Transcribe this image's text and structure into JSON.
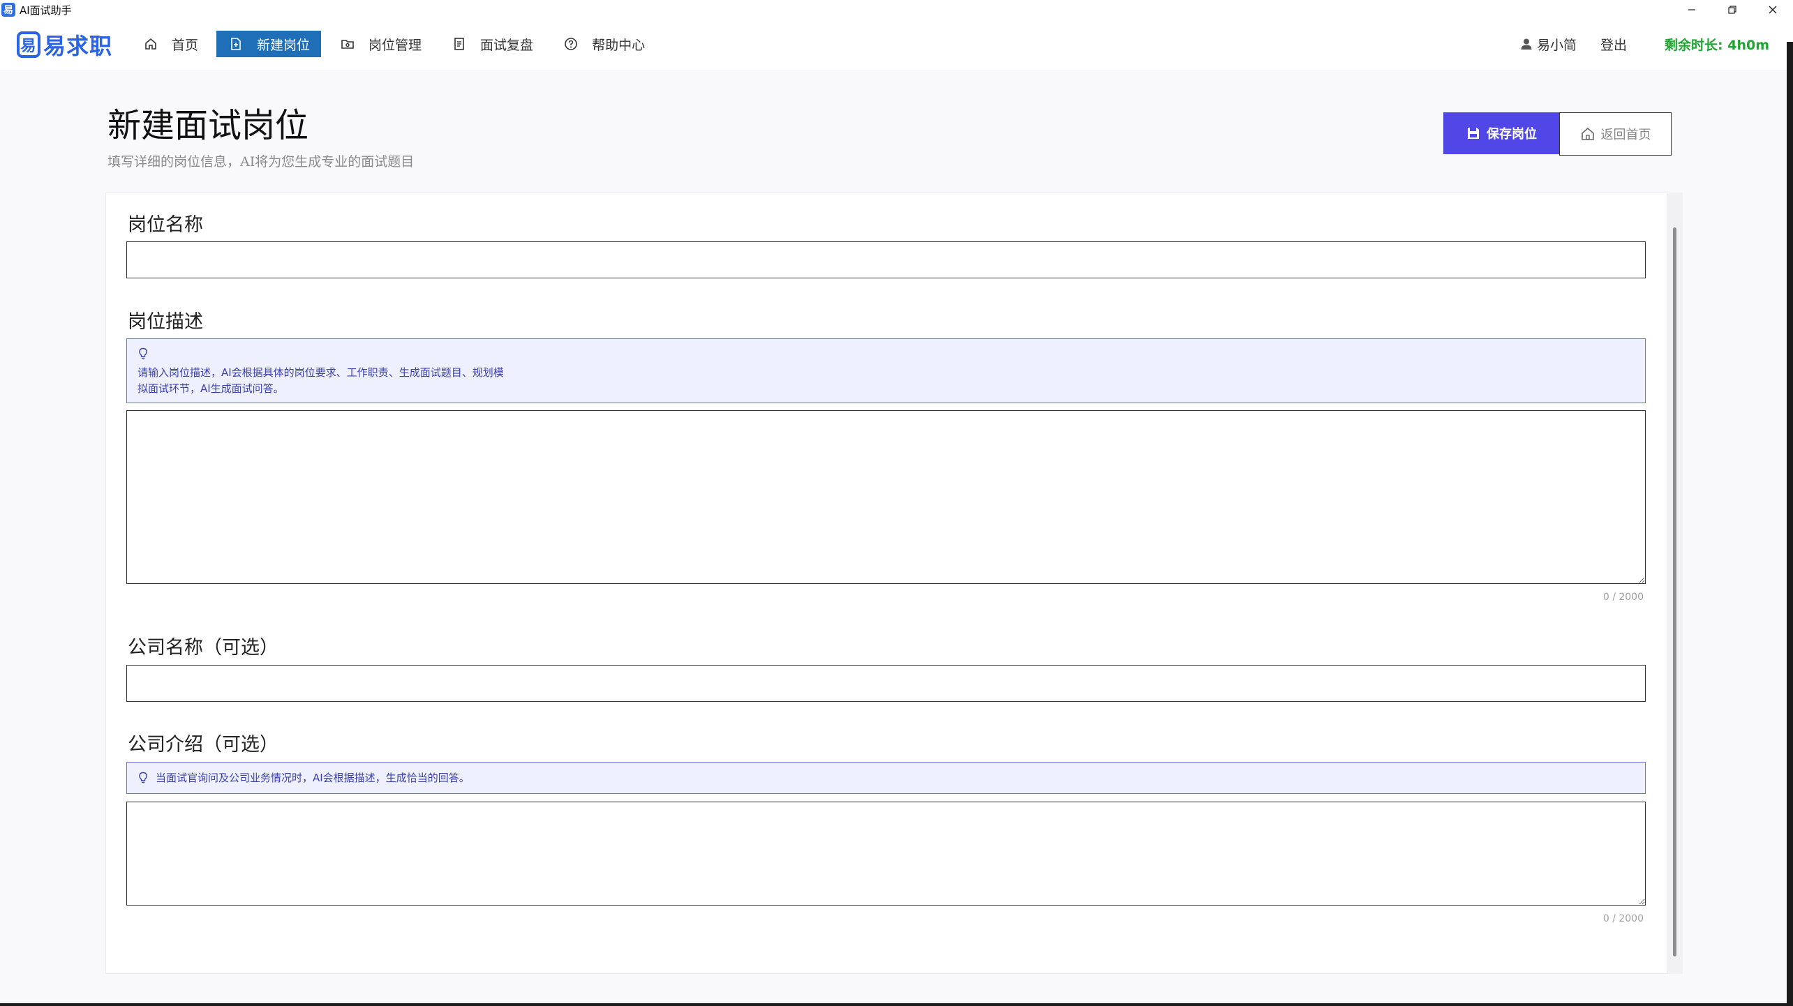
{
  "window": {
    "title": "AI面试助手",
    "app_icon": "易",
    "controls": [
      "minimize",
      "restore",
      "close"
    ]
  },
  "nav": {
    "logo_text": "易求职",
    "logo_mark": "易",
    "items": [
      {
        "label": "首页",
        "icon": "home-icon",
        "active": false
      },
      {
        "label": "新建岗位",
        "icon": "new-document-icon",
        "active": true
      },
      {
        "label": "岗位管理",
        "icon": "folder-icon",
        "active": false
      },
      {
        "label": "面试复盘",
        "icon": "review-icon",
        "active": false
      },
      {
        "label": "帮助中心",
        "icon": "help-icon",
        "active": false
      }
    ],
    "user_name": "易小简",
    "logout_label": "登出",
    "remaining_time": "剩余时长: 4h0m"
  },
  "page": {
    "title": "新建面试岗位",
    "subtitle": "填写详细的岗位信息，AI将为您生成专业的面试题目",
    "save_label": "保存岗位",
    "back_label": "返回首页"
  },
  "form": {
    "job_name": {
      "label": "岗位名称",
      "value": ""
    },
    "job_desc": {
      "label": "岗位描述",
      "hint_line1": "请输入岗位描述，AI会根据具体的岗位要求、工作职责、生成面试题目、规划模",
      "hint_line2": "拟面试环节，AI生成面试问答。",
      "value": "",
      "counter": "0 / 2000"
    },
    "company_name": {
      "label": "公司名称（可选）",
      "value": ""
    },
    "company_intro": {
      "label": "公司介绍（可选）",
      "hint": "当面试官询问及公司业务情况时，AI会根据描述，生成恰当的回答。",
      "value": "",
      "counter": "0 / 2000"
    }
  },
  "colors": {
    "accent": "#5147e6",
    "nav_active": "#1e6fb8",
    "timer": "#1fa531",
    "hint_bg": "#eef0fd",
    "hint_border": "#6a6fe0"
  }
}
